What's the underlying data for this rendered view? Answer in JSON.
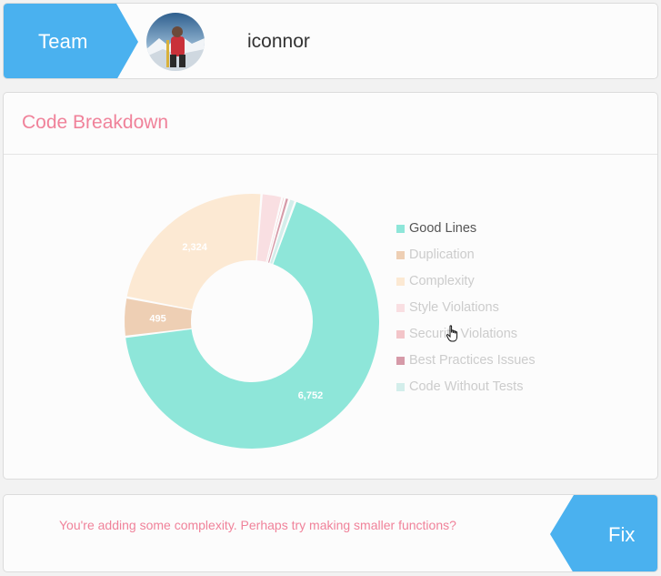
{
  "header": {
    "team_label": "Team",
    "username": "iconnor",
    "tab_color": "#4ab1ef"
  },
  "chart_card": {
    "title": "Code Breakdown"
  },
  "chart_data": {
    "type": "pie",
    "title": "Code Breakdown",
    "donut": true,
    "legend_position": "right",
    "series": [
      {
        "name": "Good Lines",
        "value": 6752,
        "label": "6,752",
        "color": "#8ee6d9",
        "active": true
      },
      {
        "name": "Duplication",
        "value": 495,
        "label": "495",
        "color": "#eecfb4",
        "active": false
      },
      {
        "name": "Complexity",
        "value": 2324,
        "label": "2,324",
        "color": "#fce9d3",
        "active": false
      },
      {
        "name": "Style Violations",
        "value": 262,
        "label": "",
        "color": "#f9dfe2",
        "active": false
      },
      {
        "name": "Security Violations",
        "value": 35,
        "label": "",
        "color": "#f3c5c9",
        "active": false
      },
      {
        "name": "Best Practices Issues",
        "value": 55,
        "label": "",
        "color": "#d69aa8",
        "active": false
      },
      {
        "name": "Code Without Tests",
        "value": 82,
        "label": "",
        "color": "#d3eeeb",
        "active": false
      }
    ]
  },
  "tip": {
    "message": "You're adding some complexity. Perhaps try making smaller functions?",
    "fix_label": "Fix"
  }
}
